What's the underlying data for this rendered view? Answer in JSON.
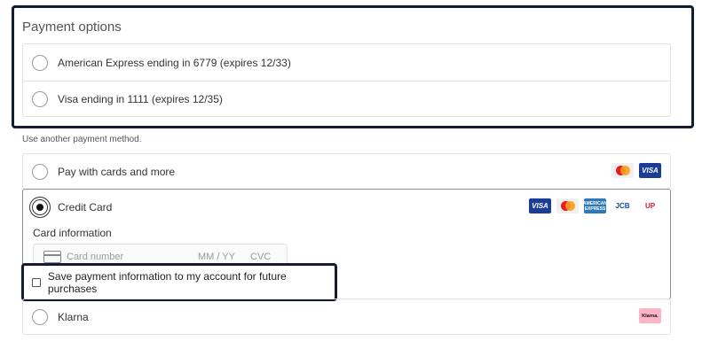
{
  "saved_payments": {
    "title": "Payment options",
    "options": [
      {
        "label": "American Express ending in 6779 (expires 12/33)"
      },
      {
        "label": "Visa ending in 1111 (expires 12/35)"
      }
    ]
  },
  "another_method_text": "Use another payment method.",
  "methods": {
    "pay_with_cards": {
      "label": "Pay with cards and more",
      "brands": [
        "mastercard-icon",
        "visa-icon"
      ]
    },
    "credit_card": {
      "label": "Credit Card",
      "selected": true,
      "brands": [
        "visa-icon",
        "mastercard-icon",
        "amex-icon",
        "jcb-icon",
        "unionpay-icon"
      ],
      "card_info_label": "Card information",
      "card_number_placeholder": "Card number",
      "expiry_placeholder": "MM / YY",
      "cvc_placeholder": "CVC"
    },
    "klarna": {
      "label": "Klarna",
      "brand_text": "Klarna."
    }
  },
  "save_checkbox": {
    "label": "Save payment information to my account for future purchases",
    "checked": false
  },
  "brand_text": {
    "visa": "VISA",
    "amex": "AMERICAN EXPRESS",
    "jcb": "JCB",
    "unionpay": "UP"
  },
  "colors": {
    "highlight_border": "#141b33",
    "visa_blue": "#1a3d97",
    "klarna_pink": "#ffb3c7"
  }
}
